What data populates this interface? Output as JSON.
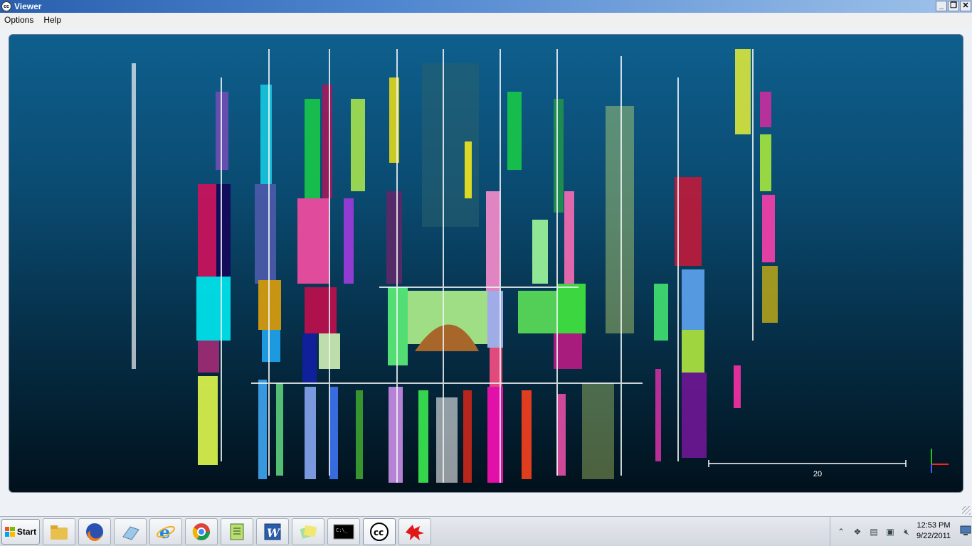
{
  "window": {
    "title": "Viewer",
    "icon": "cc-logo-icon",
    "controls": [
      "minimize",
      "restore",
      "close"
    ]
  },
  "menu": {
    "options_label": "Options",
    "help_label": "Help"
  },
  "viewport": {
    "content": "point-cloud-cathedral-facade",
    "scale_bar_label": "20",
    "axis_colors": {
      "x": "#ff2020",
      "y": "#20c020",
      "z": "#4060ff"
    }
  },
  "taskbar": {
    "start_label": "Start",
    "apps": [
      {
        "name": "windows-explorer",
        "icon": "folder-icon",
        "active": false
      },
      {
        "name": "firefox",
        "icon": "firefox-icon",
        "active": false
      },
      {
        "name": "eraser-app",
        "icon": "eraser-icon",
        "active": false
      },
      {
        "name": "internet-explorer",
        "icon": "ie-icon",
        "active": false
      },
      {
        "name": "chrome",
        "icon": "chrome-icon",
        "active": false
      },
      {
        "name": "notepad-plus",
        "icon": "notepad-icon",
        "active": false
      },
      {
        "name": "word",
        "icon": "word-icon",
        "active": false
      },
      {
        "name": "sticky-notes",
        "icon": "sticky-notes-icon",
        "active": false
      },
      {
        "name": "command-prompt",
        "icon": "cmd-icon",
        "active": false
      },
      {
        "name": "cloudcompare",
        "icon": "cc-icon",
        "active": true
      },
      {
        "name": "red-app",
        "icon": "red-splat-icon",
        "active": false
      }
    ],
    "clock_time": "12:53 PM",
    "clock_date": "9/22/2011"
  }
}
